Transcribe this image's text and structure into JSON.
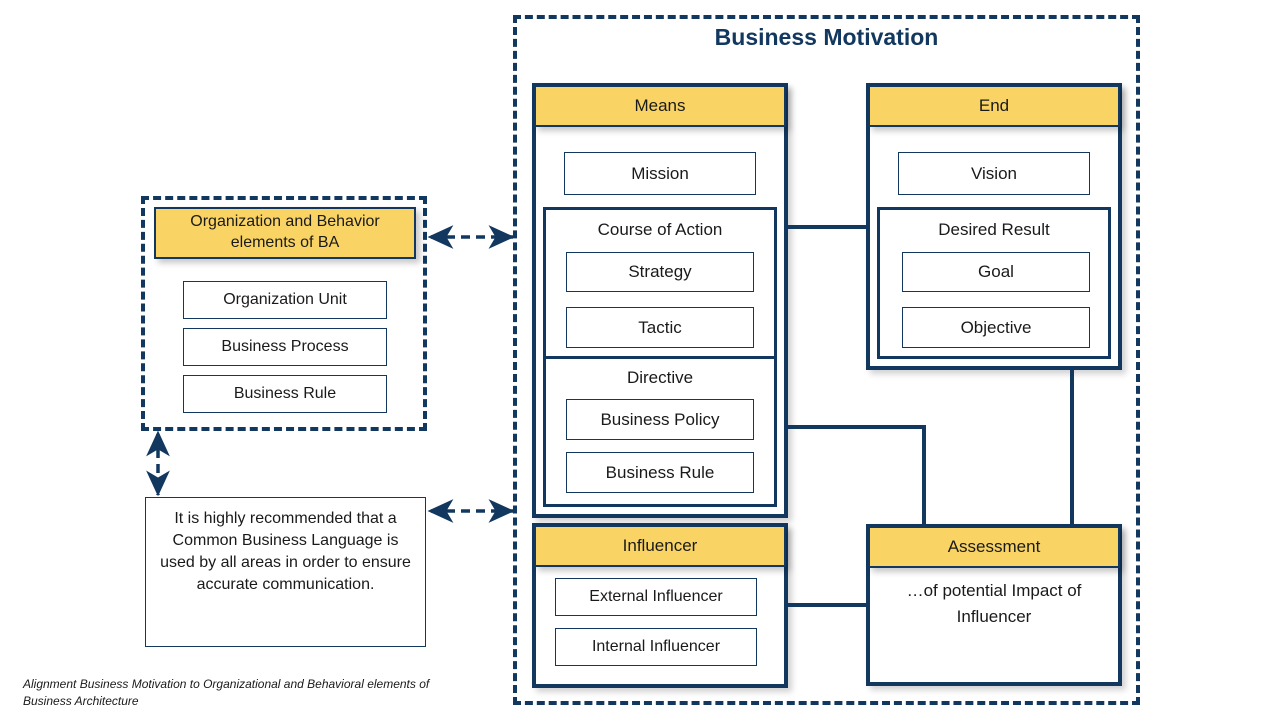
{
  "diagram": {
    "title": "Business Motivation",
    "caption": "Alignment Business Motivation to Organizational and Behavioral elements of Business Architecture",
    "colors": {
      "navy": "#123860",
      "header_yellow": "#F9D465",
      "background": "#FFFFFF"
    }
  },
  "left_panel": {
    "header": "Organization and Behavior elements of BA",
    "items": [
      {
        "label": "Organization Unit"
      },
      {
        "label": "Business Process"
      },
      {
        "label": "Business Rule"
      }
    ]
  },
  "note": {
    "text": "It is highly recommended that a Common Business Language is used by all areas in order to ensure accurate communication."
  },
  "means": {
    "header": "Means",
    "mission": "Mission",
    "course_of_action": {
      "label": "Course of Action",
      "items": [
        {
          "label": "Strategy"
        },
        {
          "label": "Tactic"
        }
      ]
    },
    "directive": {
      "label": "Directive",
      "items": [
        {
          "label": "Business Policy"
        },
        {
          "label": "Business Rule"
        }
      ]
    }
  },
  "end": {
    "header": "End",
    "vision": "Vision",
    "desired_result": {
      "label": "Desired Result",
      "items": [
        {
          "label": "Goal"
        },
        {
          "label": "Objective"
        }
      ]
    }
  },
  "influencer": {
    "header": "Influencer",
    "items": [
      {
        "label": "External Influencer"
      },
      {
        "label": "Internal Influencer"
      }
    ]
  },
  "assessment": {
    "header": "Assessment",
    "body": "…of potential Impact of Influencer"
  }
}
